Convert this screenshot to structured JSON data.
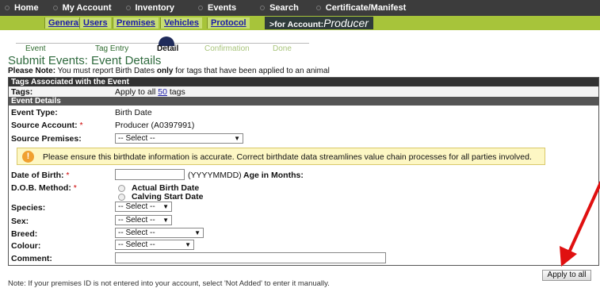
{
  "topnav": {
    "items": [
      "Home",
      "My Account",
      "Inventory",
      "Events",
      "Search",
      "Certificate/Manifest"
    ]
  },
  "subnav": {
    "tabs": [
      "General",
      "Users",
      "Premises",
      "Vehicles",
      "Protocol"
    ],
    "account_prefix": ">for Account:",
    "account_name": "Producer"
  },
  "steps": {
    "items": [
      "Event",
      "Tag Entry",
      "Detail",
      "Confirmation",
      "Done"
    ]
  },
  "page": {
    "title": "Submit Events: Event Details",
    "note_prefix": "Please Note:",
    "note_text_1": " You must report Birth Dates ",
    "note_bold": "only",
    "note_text_2": " for tags that have been applied to an animal"
  },
  "tags_section": {
    "header": "Tags Associated with the Event",
    "label": "Tags:",
    "value_prefix": "Apply to all ",
    "count": "50",
    "value_suffix": " tags"
  },
  "details": {
    "header": "Event Details",
    "event_type_label": "Event Type:",
    "event_type_value": "Birth Date",
    "source_account_label": "Source Account:",
    "source_account_value": "Producer (A0397991)",
    "source_premises_label": "Source Premises:",
    "source_premises_value": "-- Select --",
    "alert_text": "Please ensure this birthdate information is accurate. Correct birthdate data streamlines value chain processes for all parties involved.",
    "dob_label": "Date of Birth:",
    "dob_value": "",
    "dob_format": "(YYYYMMDD)",
    "age_label": "Age in Months:",
    "dob_method_label": "D.O.B. Method:",
    "dob_method_options": [
      "Actual Birth Date",
      "Calving Start Date"
    ],
    "species_label": "Species:",
    "species_value": "-- Select --",
    "sex_label": "Sex:",
    "sex_value": "-- Select --",
    "breed_label": "Breed:",
    "breed_value": "-- Select --",
    "colour_label": "Colour:",
    "colour_value": "-- Select --",
    "comment_label": "Comment:",
    "comment_value": "",
    "required_mark": "*"
  },
  "apply_button": "Apply to all",
  "footnote": "Note: If your premises ID is not entered into your account, select 'Not Added' to enter it manually.",
  "colors": {
    "topnav": "#3c3c3c",
    "subnav": "#a7c43a",
    "title": "#2f6a3e",
    "annotation_arrow": "#e01010"
  }
}
